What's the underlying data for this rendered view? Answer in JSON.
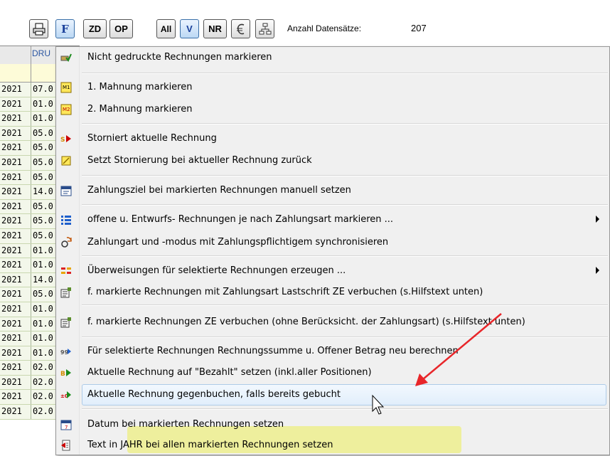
{
  "toolbar": {
    "buttons": [
      {
        "label": "",
        "icon": "print-icon"
      },
      {
        "label": "F"
      },
      {
        "label": "ZD"
      },
      {
        "label": "OP"
      },
      {
        "label": "All"
      },
      {
        "label": "V"
      },
      {
        "label": "NR"
      },
      {
        "label": "",
        "icon": "euro-sign-icon"
      },
      {
        "label": "",
        "icon": "hierarchy-icon"
      }
    ],
    "record_count_label": "Anzahl Datensätze:",
    "record_count_value": "207"
  },
  "grid": {
    "header_col2": "DRU",
    "rows": [
      {
        "c1": "2021",
        "c2": "07.0"
      },
      {
        "c1": "2021",
        "c2": "01.0"
      },
      {
        "c1": "2021",
        "c2": "01.0"
      },
      {
        "c1": "2021",
        "c2": "05.0"
      },
      {
        "c1": "2021",
        "c2": "05.0"
      },
      {
        "c1": "2021",
        "c2": "05.0"
      },
      {
        "c1": "2021",
        "c2": "05.0"
      },
      {
        "c1": "2021",
        "c2": "14.0"
      },
      {
        "c1": "2021",
        "c2": "05.0"
      },
      {
        "c1": "2021",
        "c2": "05.0"
      },
      {
        "c1": "2021",
        "c2": "05.0"
      },
      {
        "c1": "2021",
        "c2": "01.0"
      },
      {
        "c1": "2021",
        "c2": "01.0"
      },
      {
        "c1": "2021",
        "c2": "14.0"
      },
      {
        "c1": "2021",
        "c2": "05.0"
      },
      {
        "c1": "2021",
        "c2": "01.0"
      },
      {
        "c1": "2021",
        "c2": "01.0"
      },
      {
        "c1": "2021",
        "c2": "01.0"
      },
      {
        "c1": "2021",
        "c2": "01.0"
      },
      {
        "c1": "2021",
        "c2": "02.0"
      },
      {
        "c1": "2021",
        "c2": "02.0"
      },
      {
        "c1": "2021",
        "c2": "02.0"
      },
      {
        "c1": "2021",
        "c2": "02.0"
      }
    ]
  },
  "menu": {
    "items": [
      {
        "label": "Nicht gedruckte Rechnungen markieren",
        "icon": "printer-check-icon"
      },
      {
        "label": "1. Mahnung markieren",
        "icon": "m1-icon"
      },
      {
        "label": "2. Mahnung markieren",
        "icon": "m2-icon"
      },
      {
        "label": "Storniert aktuelle Rechnung",
        "icon": "storno-icon"
      },
      {
        "label": "Setzt Stornierung bei aktueller Rechnung zurück",
        "icon": "storno-reset-icon"
      },
      {
        "label": "Zahlungsziel bei markierten Rechnungen manuell setzen",
        "icon": "calendar-money-icon"
      },
      {
        "label": "offene u. Entwurfs- Rechnungen je nach Zahlungsart markieren ...",
        "icon": "list-icon"
      },
      {
        "label": "Zahlungart und -modus mit Zahlungspflichtigem synchronisieren",
        "icon": "sync-icon"
      },
      {
        "label": "Überweisungen für selektierte Rechnungen erzeugen ...",
        "icon": "transfer-icon"
      },
      {
        "label": "f. markierte Rechnungen mit Zahlungsart Lastschrift ZE verbuchen (s.Hilfstext unten)",
        "icon": "book-entry-icon"
      },
      {
        "label": "f. markierte Rechnungen ZE verbuchen (ohne Berücksicht. der Zahlungsart) (s.Hilfstext unten)",
        "icon": "book-entry-icon"
      },
      {
        "label": "Für selektierte Rechnungen Rechnungssumme u. Offener Betrag neu berechnen",
        "icon": "recalc-icon"
      },
      {
        "label": "Aktuelle Rechnung auf \"Bezahlt\" setzen (inkl.aller Positionen)",
        "icon": "paid-icon"
      },
      {
        "label": "Aktuelle Rechnung gegenbuchen, falls bereits gebucht",
        "icon": "counter-booking-icon"
      },
      {
        "label": "Datum bei markierten Rechnungen setzen",
        "icon": "calendar-icon"
      },
      {
        "label": "Text in JAHR bei allen markierten Rechnungen setzen",
        "icon": "text-icon"
      }
    ],
    "colors": {
      "highlight_border": "#aecbe8",
      "yellow_marker": "#ecee5a",
      "arrow": "#e8262a"
    }
  }
}
